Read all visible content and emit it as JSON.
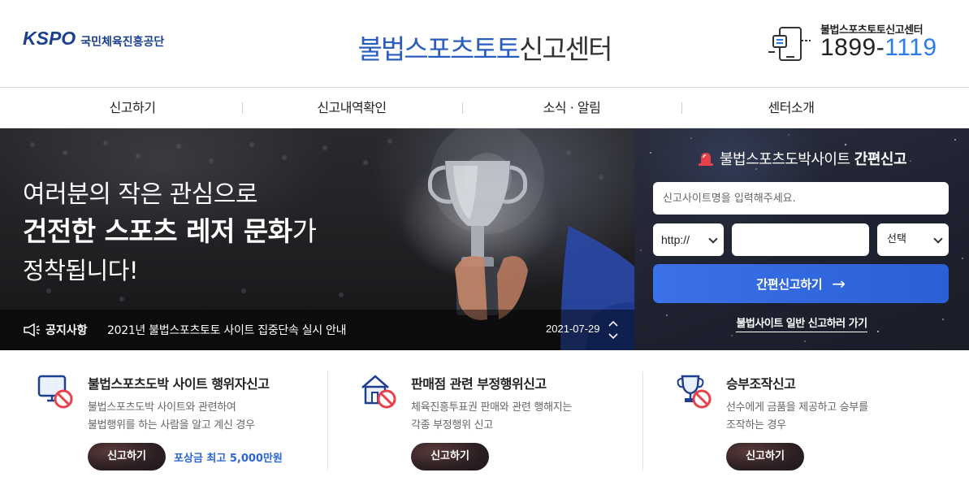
{
  "header": {
    "logo_mark": "KSPO",
    "logo_org": "국민체육진흥공단",
    "title_highlight": "불법스포츠토토",
    "title_rest": "신고센터",
    "call_label": "불법스포츠토토신고센터",
    "call_number_a": "1899-",
    "call_number_b": "1119"
  },
  "nav": {
    "items": [
      {
        "label": "신고하기"
      },
      {
        "label": "신고내역확인"
      },
      {
        "label": "소식 · 알림"
      },
      {
        "label": "센터소개"
      }
    ]
  },
  "hero": {
    "line1": "여러분의 작은 관심으로",
    "line2_bold": "건전한 스포츠 레저 문화",
    "line2_tail": "가",
    "line3": "정착됩니다!",
    "notice_label": "공지사항",
    "notice_text": "2021년 불법스포츠토토 사이트 집중단속 실시 안내",
    "notice_date": "2021-07-29"
  },
  "quick_report": {
    "title_normal": "불법스포츠도박사이트 ",
    "title_bold": "간편신고",
    "site_placeholder": "신고사이트명을 입력해주세요.",
    "protocol_value": "http://",
    "url_value": "",
    "domain_value": "선택",
    "submit_label": "간편신고하기",
    "general_link": "불법사이트 일반 신고하러 가기"
  },
  "cards": [
    {
      "title": "불법스포츠도박 사이트 행위자신고",
      "desc1": "불법스포츠도박 사이트와 관련하여",
      "desc2": "불법행위를 하는 사람을 알고 계신 경우",
      "button": "신고하기",
      "reward": "포상금 최고 5,000만원",
      "icon": "monitor-prohibited-icon"
    },
    {
      "title": "판매점 관련 부정행위신고",
      "desc1": "체육진흥투표권 판매와 관련 행해지는",
      "desc2": "각종 부정행위 신고",
      "button": "신고하기",
      "icon": "store-prohibited-icon"
    },
    {
      "title": "승부조작신고",
      "desc1": "선수에게 금품을 제공하고 승부를",
      "desc2": "조작하는 경우",
      "button": "신고하기",
      "icon": "trophy-prohibited-icon"
    }
  ],
  "colors": {
    "brand_blue": "#2b5cc0",
    "accent_blue": "#2b7de9",
    "button_blue": "#3b72e8",
    "prohibit_red": "#e8414a",
    "dark_button": "#2b1f22"
  }
}
